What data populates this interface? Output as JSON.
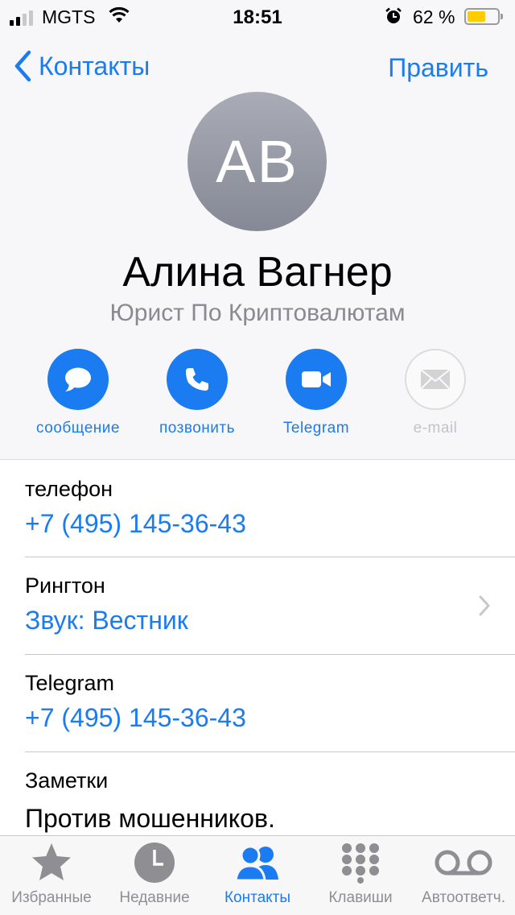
{
  "status_bar": {
    "carrier": "MGTS",
    "time": "18:51",
    "battery_percent": "62 %",
    "battery_level": 0.62
  },
  "nav": {
    "back_label": "Контакты",
    "edit_label": "Править"
  },
  "contact": {
    "initials": "AB",
    "name": "Алина Вагнер",
    "job_title": "Юрист По Криптовалютам"
  },
  "actions": [
    {
      "label": "сообщение",
      "icon": "message-icon",
      "enabled": true
    },
    {
      "label": "позвонить",
      "icon": "phone-icon",
      "enabled": true
    },
    {
      "label": "Telegram",
      "icon": "video-icon",
      "enabled": true
    },
    {
      "label": "e-mail",
      "icon": "mail-icon",
      "enabled": false
    }
  ],
  "fields": {
    "phone": {
      "title": "телефон",
      "value": "+7 (495) 145-36-43"
    },
    "ringtone": {
      "title": "Рингтон",
      "value": "Звук: Вестник"
    },
    "telegram": {
      "title": "Telegram",
      "value": "+7 (495) 145-36-43"
    },
    "notes": {
      "title": "Заметки",
      "value": "Против мошенников."
    }
  },
  "tabs": [
    {
      "label": "Избранные",
      "icon": "star-icon",
      "active": false
    },
    {
      "label": "Недавние",
      "icon": "clock-icon",
      "active": false
    },
    {
      "label": "Контакты",
      "icon": "contacts-icon",
      "active": true
    },
    {
      "label": "Клавиши",
      "icon": "keypad-icon",
      "active": false
    },
    {
      "label": "Автоответч.",
      "icon": "voicemail-icon",
      "active": false
    }
  ],
  "colors": {
    "accent": "#1a7cf0",
    "battery_fill": "#ffcc00",
    "inactive_tab": "#8e8e93"
  }
}
